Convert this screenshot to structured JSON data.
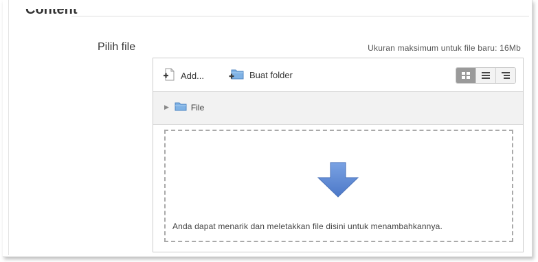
{
  "section": {
    "legend": "Content"
  },
  "field": {
    "label": "Pilih file"
  },
  "max_size_text": "Ukuran maksimum untuk file baru: 16Mb",
  "toolbar": {
    "add_label": "Add...",
    "new_folder_label": "Buat folder",
    "view_modes": [
      {
        "icon": "grid-view-icon",
        "active": true
      },
      {
        "icon": "list-view-icon",
        "active": false
      },
      {
        "icon": "tree-view-icon",
        "active": false
      }
    ]
  },
  "path": {
    "root_label": "File"
  },
  "dropzone": {
    "hint": "Anda dapat menarik dan meletakkan file disini untuk menambahkannya."
  },
  "colors": {
    "arrow": "#5b86d1",
    "folder": "#7fb2e5",
    "border": "#cccccc"
  }
}
